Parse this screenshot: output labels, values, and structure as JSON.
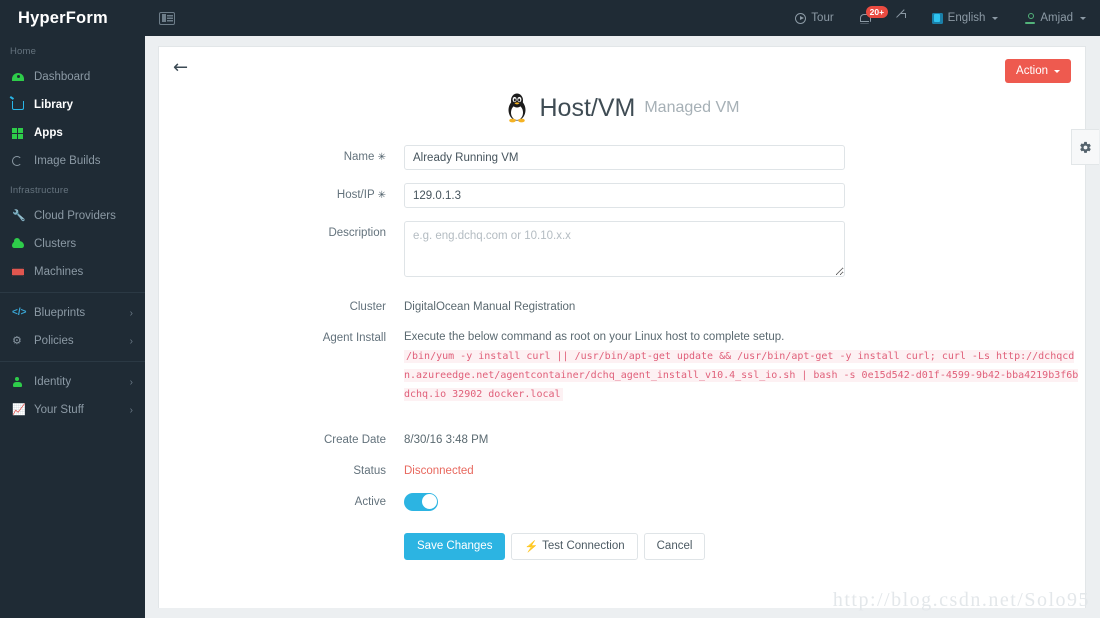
{
  "brand": "HyperForm",
  "sidebar": {
    "sections": [
      {
        "title": "Home",
        "items": [
          {
            "label": "Dashboard",
            "icon": "gauge-icon",
            "bright": false,
            "caret": ""
          },
          {
            "label": "Library",
            "icon": "cart-icon",
            "bright": true,
            "caret": ""
          },
          {
            "label": "Apps",
            "icon": "grid-icon",
            "bright": true,
            "caret": ""
          },
          {
            "label": "Image Builds",
            "icon": "ring-icon",
            "bright": false,
            "caret": ""
          }
        ]
      },
      {
        "title": "Infrastructure",
        "items": [
          {
            "label": "Cloud Providers",
            "icon": "wrench-icon",
            "bright": false,
            "caret": ""
          },
          {
            "label": "Clusters",
            "icon": "cloud-icon",
            "bright": false,
            "caret": ""
          },
          {
            "label": "Machines",
            "icon": "server-icon",
            "bright": false,
            "caret": ""
          }
        ]
      },
      {
        "title": "",
        "items": [
          {
            "label": "Blueprints",
            "icon": "code-icon",
            "bright": false,
            "caret": "›"
          },
          {
            "label": "Policies",
            "icon": "gear-icon",
            "bright": false,
            "caret": "›"
          }
        ]
      },
      {
        "title": "",
        "items": [
          {
            "label": "Identity",
            "icon": "person-icon",
            "bright": false,
            "caret": "›"
          },
          {
            "label": "Your Stuff",
            "icon": "chart-icon",
            "bright": false,
            "caret": "›"
          }
        ]
      }
    ]
  },
  "topbar": {
    "tour_label": "Tour",
    "notification_badge": "20+",
    "language_label": "English",
    "user_label": "Amjad"
  },
  "page": {
    "back_label": "←",
    "action_label": "Action",
    "title": "Host/VM",
    "subtitle": "Managed VM"
  },
  "form": {
    "name_label": "Name",
    "name_value": "Already Running VM",
    "name_placeholder": "",
    "hostip_label": "Host/IP",
    "hostip_value": "129.0.1.3",
    "hostip_placeholder": "",
    "description_label": "Description",
    "description_value": "",
    "description_placeholder": "e.g. eng.dchq.com or 10.10.x.x",
    "cluster_label": "Cluster",
    "cluster_value": "DigitalOcean Manual Registration",
    "agent_install_label": "Agent Install",
    "agent_install_note": "Execute the below command as root on your Linux host to complete setup.",
    "agent_install_command": "/bin/yum -y install curl || /usr/bin/apt-get update && /usr/bin/apt-get -y install curl; curl -Ls http://dchqcdn.azureedge.net/agentcontainer/dchq_agent_install_v10.4_ssl_io.sh | bash -s 0e15d542-d01f-4599-9b42-bba4219b3f6b dchq.io 32902 docker.local",
    "create_date_label": "Create Date",
    "create_date_value": "8/30/16 3:48 PM",
    "status_label": "Status",
    "status_value": "Disconnected",
    "active_label": "Active",
    "active_on": true,
    "required_marker": "✳"
  },
  "buttons": {
    "save_label": "Save Changes",
    "test_label": "Test Connection",
    "test_icon": "⚡",
    "cancel_label": "Cancel"
  },
  "watermark": "http://blog.csdn.net/Solo95",
  "colors": {
    "sidebar_bg": "#1f2b35",
    "accent_blue": "#2cb4e2",
    "action_red": "#ee5a4f",
    "status_red": "#e8685e",
    "code_pink": "#e0607a",
    "page_bg": "#eceff1"
  }
}
